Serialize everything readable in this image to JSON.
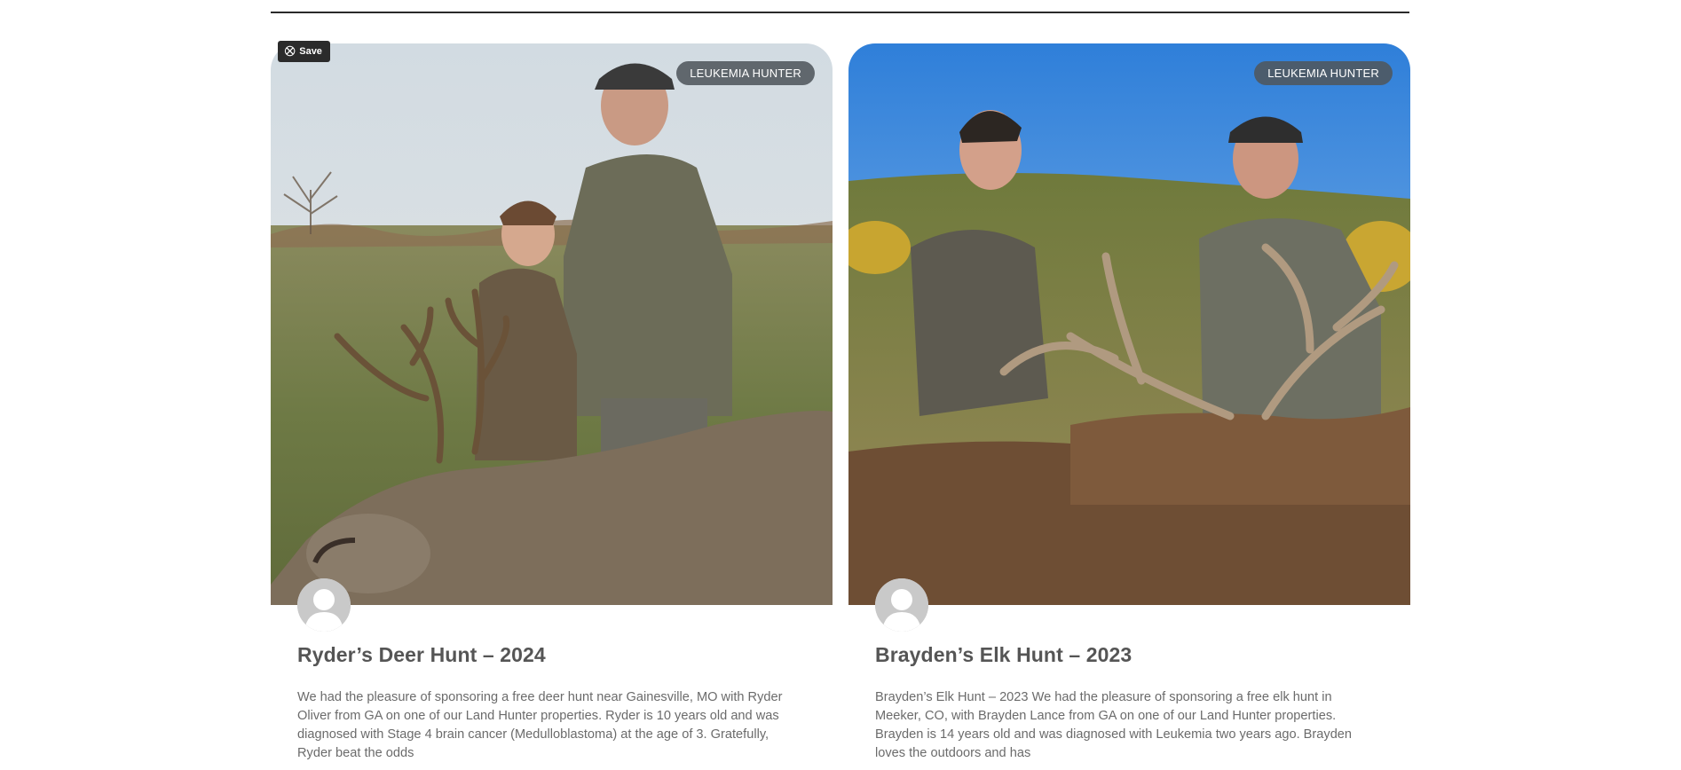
{
  "save_button": {
    "label": "Save",
    "icon": "pin-icon"
  },
  "posts": [
    {
      "category": "LEUKEMIA HUNTER",
      "title": "Ryder’s Deer Hunt – 2024",
      "excerpt": "We had the pleasure of sponsoring a free deer hunt near Gainesville, MO with Ryder Oliver from GA on one of our Land Hunter properties. Ryder is 10 years old and was diagnosed with Stage 4 brain cancer (Medulloblastoma) at the age of 3. Gratefully, Ryder beat the odds",
      "image": "photo of a boy and a man kneeling behind a whitetail deer with antlers in a grassy field",
      "author_avatar": "default-user-avatar"
    },
    {
      "category": "LEUKEMIA HUNTER",
      "title": "Brayden’s Elk Hunt – 2023",
      "excerpt": "Brayden’s Elk Hunt – 2023 We had the pleasure of sponsoring a free elk hunt in Meeker, CO, with Brayden Lance from GA on one of our Land Hunter properties.  Brayden is 14 years old and was diagnosed with Leukemia two years ago.  Brayden loves the outdoors and has",
      "image": "photo of a boy and a man in camouflage kneeling behind a bull elk with large antlers under a blue sky",
      "author_avatar": "default-user-avatar"
    }
  ]
}
